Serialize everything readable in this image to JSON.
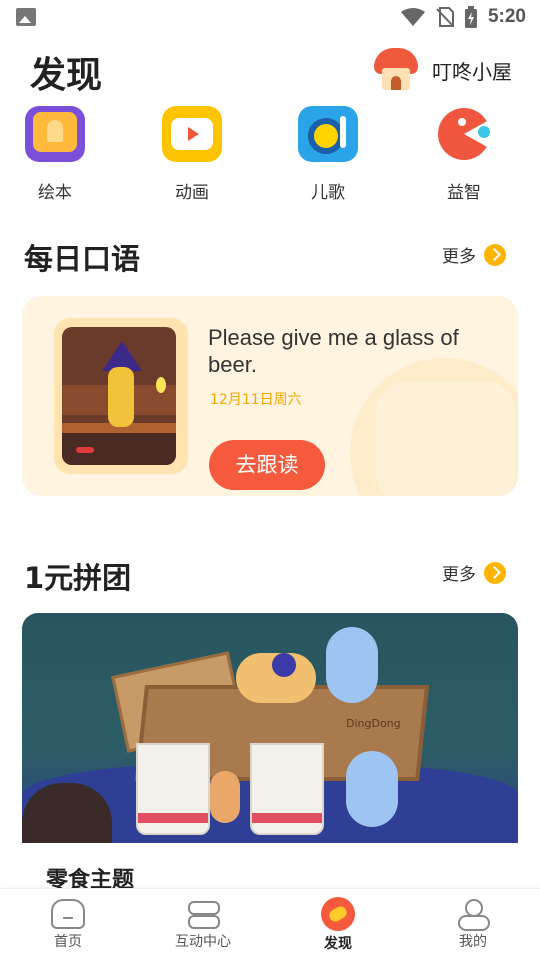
{
  "status_bar": {
    "time": "5:20"
  },
  "header": {
    "title": "发现",
    "house_label": "叮咚小屋"
  },
  "categories": [
    {
      "label": "绘本",
      "icon": "picture-book-icon"
    },
    {
      "label": "动画",
      "icon": "animation-tv-icon"
    },
    {
      "label": "儿歌",
      "icon": "music-disc-icon"
    },
    {
      "label": "益智",
      "icon": "puzzle-pacman-icon"
    }
  ],
  "daily": {
    "section_title": "每日口语",
    "more_label": "更多",
    "sentence": "Please give me a glass of beer.",
    "date": "12月11日周六",
    "button_label": "去跟读"
  },
  "group_buy": {
    "section_title": "1元拼团",
    "more_label": "更多",
    "banner_text": "DingDong",
    "item_title": "零食主题"
  },
  "bottom_nav": {
    "items": [
      {
        "label": "首页",
        "active": false
      },
      {
        "label": "互动中心",
        "active": false
      },
      {
        "label": "发现",
        "active": true
      },
      {
        "label": "我的",
        "active": false
      }
    ]
  },
  "colors": {
    "accent": "#f55a3c",
    "more_badge": "#ffb400",
    "date_text": "#f2a700",
    "card_bg": "#fff4e0"
  }
}
